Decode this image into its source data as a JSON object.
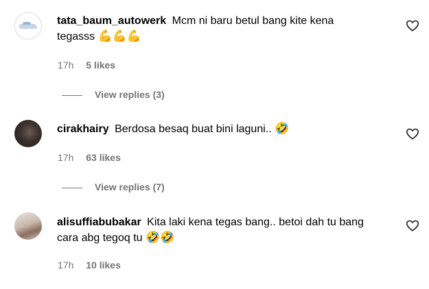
{
  "comments": [
    {
      "username": "tata_baum_autowerk",
      "text": "Mcm ni baru betul bang kite kena tegasss",
      "emojis": "💪💪💪",
      "time": "17h",
      "likes": "5 likes",
      "view_replies": "View replies (3)",
      "avatar_icon": "logo-avatar"
    },
    {
      "username": "cirakhairy",
      "text": "Berdosa besaq buat bini laguni..",
      "emojis": "🤣",
      "time": "17h",
      "likes": "63 likes",
      "view_replies": "View replies (7)",
      "avatar_icon": "profile-avatar"
    },
    {
      "username": "alisuffiabubakar",
      "text": "Kita laki kena tegas bang.. betoi dah tu bang cara abg tegoq tu",
      "emojis": "🤣🤣",
      "time": "17h",
      "likes": "10 likes",
      "avatar_icon": "profile-avatar"
    }
  ],
  "icons": {
    "like": "heart-outline-icon"
  },
  "colors": {
    "secondary_text": "#737373",
    "text": "#000000",
    "background": "#ffffff"
  }
}
